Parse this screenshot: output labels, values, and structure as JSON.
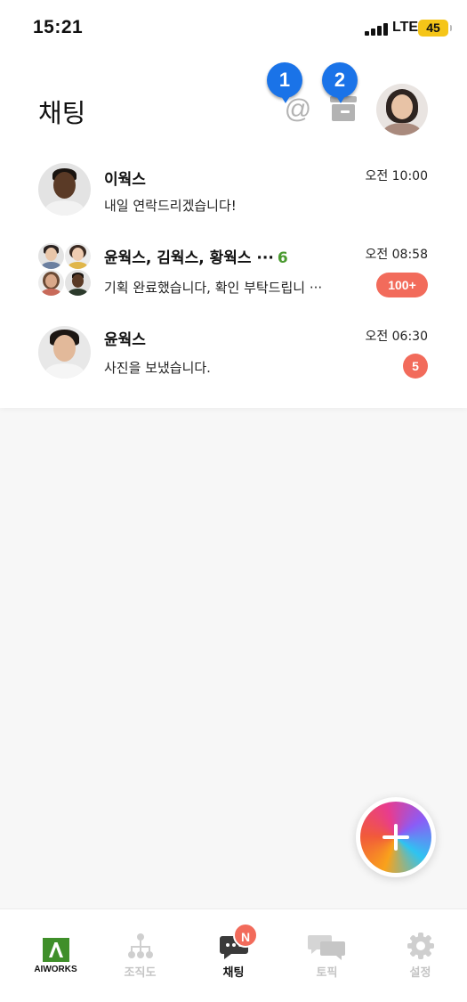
{
  "status_bar": {
    "time": "15:21",
    "network": "LTE",
    "battery": "45"
  },
  "header": {
    "title": "채팅",
    "mention_icon": "@",
    "callouts": [
      "1",
      "2"
    ]
  },
  "chats": [
    {
      "name": "이웍스",
      "member_count": "",
      "time": "오전 10:00",
      "preview": "내일 연락드리겠습니다!",
      "unread": ""
    },
    {
      "name": "윤웍스, 김웍스, 황웍스 ···",
      "member_count": "6",
      "time": "오전 08:58",
      "preview": "기획 완료했습니다, 확인 부탁드립니 ···",
      "unread": "100+"
    },
    {
      "name": "윤웍스",
      "member_count": "",
      "time": "오전 06:30",
      "preview": "사진을 보냈습니다.",
      "unread": "5"
    }
  ],
  "bottom_nav": {
    "items": [
      {
        "label": "AIWORKS",
        "icon": "logo-icon"
      },
      {
        "label": "조직도",
        "icon": "org-chart-icon"
      },
      {
        "label": "채팅",
        "icon": "chat-icon"
      },
      {
        "label": "토픽",
        "icon": "topic-icon"
      },
      {
        "label": "설정",
        "icon": "settings-icon"
      }
    ],
    "chat_badge": "N"
  },
  "colors": {
    "accent_green": "#4a9a2f",
    "badge_red": "#f26b5b",
    "callout_blue": "#1a73e8",
    "inactive_gray": "#c4c4c4"
  }
}
